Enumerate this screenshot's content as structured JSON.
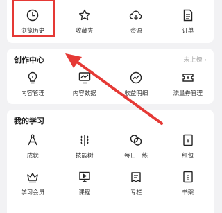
{
  "top_row": [
    {
      "label": "浏览历史",
      "icon": "clock-icon"
    },
    {
      "label": "收藏夹",
      "icon": "star-icon"
    },
    {
      "label": "资源",
      "icon": "cloud-download-icon"
    },
    {
      "label": "订单",
      "icon": "document-icon"
    }
  ],
  "creation_center": {
    "title": "创作中心",
    "link": "未上榜 ›",
    "items": [
      {
        "label": "内容管理",
        "icon": "lightbulb-icon"
      },
      {
        "label": "内容数据",
        "icon": "monitor-chart-icon"
      },
      {
        "label": "收益明细",
        "icon": "trend-circle-icon"
      },
      {
        "label": "流量券管理",
        "icon": "ticket-icon"
      }
    ]
  },
  "my_study": {
    "title": "我的学习",
    "rows": [
      [
        {
          "label": "成就",
          "icon": "compass-icon"
        },
        {
          "label": "技能树",
          "icon": "skill-tree-icon"
        },
        {
          "label": "每日一练",
          "icon": "double-circle-icon"
        },
        {
          "label": "红包",
          "icon": "red-packet-icon"
        }
      ],
      [
        {
          "label": "学习会员",
          "icon": "crown-icon"
        },
        {
          "label": "课程",
          "icon": "presentation-icon"
        },
        {
          "label": "专栏",
          "icon": "column-icon"
        },
        {
          "label": "书架",
          "icon": "book-icon"
        }
      ]
    ]
  },
  "annotation_color": "#e53935"
}
